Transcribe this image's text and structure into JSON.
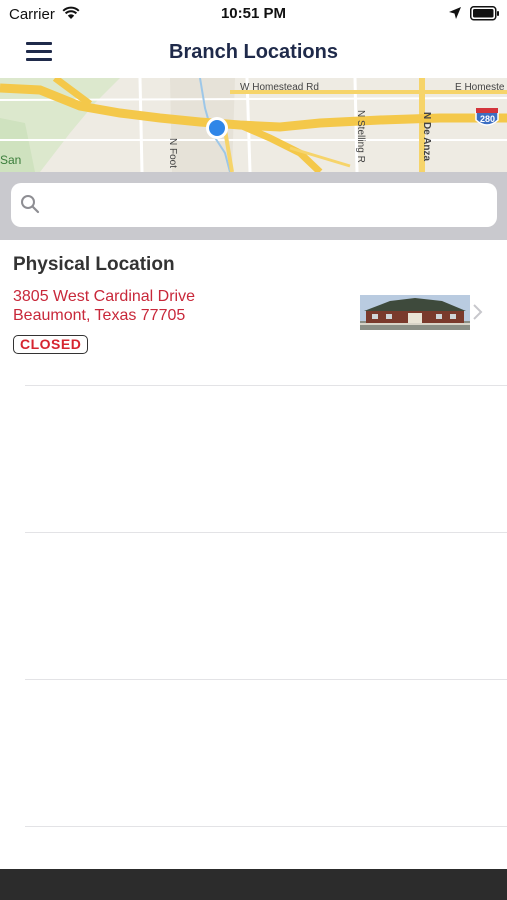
{
  "status_bar": {
    "carrier": "Carrier",
    "time": "10:51 PM"
  },
  "nav": {
    "title": "Branch Locations"
  },
  "map": {
    "labels": {
      "homestead_w": "W Homestead Rd",
      "homestead_e": "E Homeste",
      "stelling": "N Stelling R",
      "de_anza": "N De Anza",
      "foothill": "N Foot",
      "san": "San",
      "interstate": "280"
    }
  },
  "search": {
    "value": "",
    "placeholder": ""
  },
  "locations": [
    {
      "heading": "Physical Location",
      "address_line1": "3805 West Cardinal Drive",
      "address_line2": "Beaumont, Texas 77705",
      "status": "CLOSED"
    }
  ],
  "colors": {
    "nav_title": "#1f2a4a",
    "address": "#c8283a",
    "closed": "#d6242f",
    "search_bg": "#c9c9ce",
    "bottom_bar": "#2c2c2c"
  }
}
